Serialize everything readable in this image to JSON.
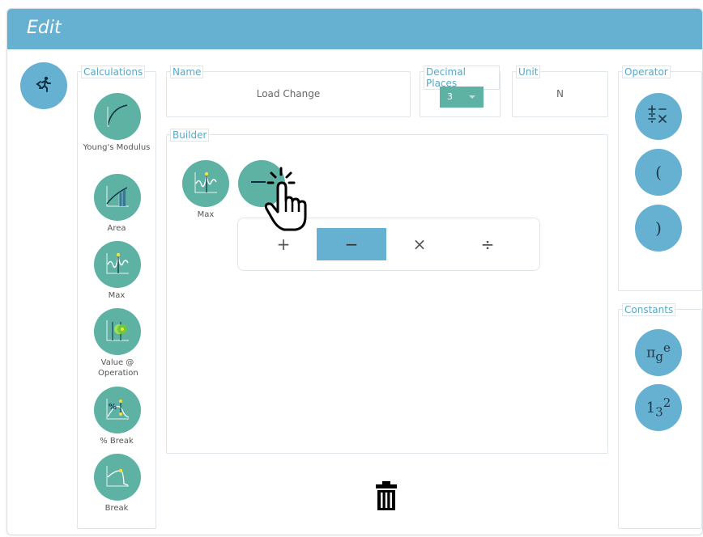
{
  "window": {
    "title": "Edit"
  },
  "back_button": {
    "icon": "back-run-icon"
  },
  "calculations": {
    "legend": "Calculations",
    "items": [
      {
        "label": "Young's Modulus",
        "icon": "youngs-modulus-icon"
      },
      {
        "label": "Area",
        "icon": "area-icon"
      },
      {
        "label": "Max",
        "icon": "max-icon"
      },
      {
        "label": "Value @ Operation",
        "icon": "value-at-operation-icon"
      },
      {
        "label": "% Break",
        "icon": "percent-break-icon"
      },
      {
        "label": "Break",
        "icon": "break-icon"
      }
    ]
  },
  "name": {
    "legend": "Name",
    "value": "Load Change"
  },
  "decimal_places": {
    "legend": "Decimal Places",
    "value": "3"
  },
  "unit": {
    "legend": "Unit",
    "value": "N"
  },
  "builder": {
    "legend": "Builder",
    "tokens": [
      {
        "label": "Max",
        "icon": "max-icon"
      },
      {
        "label": "",
        "icon": "minus-icon"
      }
    ],
    "operator_menu": [
      {
        "label": "+",
        "active": false
      },
      {
        "label": "−",
        "active": true
      },
      {
        "label": "×",
        "active": false
      },
      {
        "label": "÷",
        "active": false
      }
    ]
  },
  "operator": {
    "legend": "Operator",
    "items": [
      {
        "label": "±÷×",
        "icon": "arithmetic-operators-icon"
      },
      {
        "label": "("
      },
      {
        "label": ")"
      }
    ]
  },
  "constants": {
    "legend": "Constants",
    "items": [
      {
        "icon": "constants-icon",
        "main": "π",
        "sub": "g",
        "sup": "e"
      },
      {
        "icon": "numbers-icon",
        "main": "1",
        "sub": "3",
        "sup": "2"
      }
    ]
  },
  "colors": {
    "title_bar": "#66b0d1",
    "teal": "#5eb2a3",
    "legend_text": "#5aa7c5"
  }
}
